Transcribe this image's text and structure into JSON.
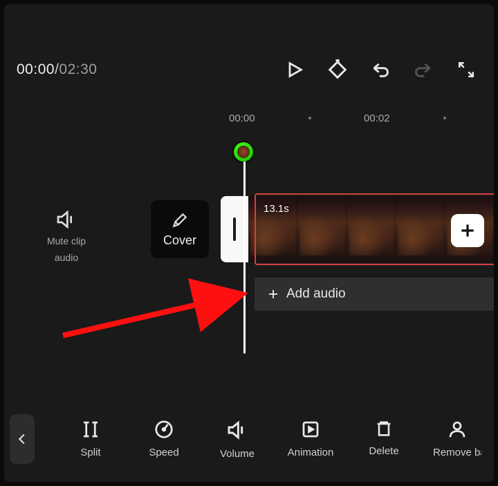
{
  "timecode": {
    "current": "00:00",
    "sep": "/",
    "total": "02:30"
  },
  "ruler": {
    "t0": "00:00",
    "t1": "00:02"
  },
  "side": {
    "mute_label_line1": "Mute clip",
    "mute_label_line2": "audio"
  },
  "cover": {
    "label": "Cover"
  },
  "clip": {
    "duration": "13.1s"
  },
  "audio": {
    "label": "Add audio"
  },
  "tools": {
    "split": "Split",
    "speed": "Speed",
    "volume": "Volume",
    "animation": "Animation",
    "delete": "Delete",
    "remove_bg": "Remove background"
  }
}
